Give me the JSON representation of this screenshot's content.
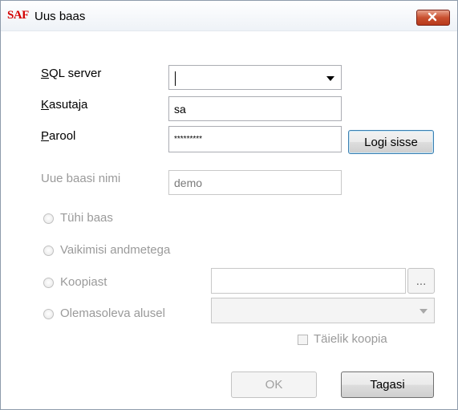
{
  "window": {
    "logo": "SAF",
    "title": "Uus baas"
  },
  "form": {
    "sql_server_label": "SQL server",
    "sql_server_value": "",
    "user_label": "Kasutaja",
    "user_value": "sa",
    "password_label": "Parool",
    "password_value": "*********",
    "login_button": "Logi sisse",
    "db_name_label": "Uue baasi nimi",
    "db_name_value": "demo"
  },
  "options": {
    "empty": "Tühi baas",
    "default_data": "Vaikimisi andmetega",
    "from_copy": "Koopiast",
    "based_on_existing": "Olemasoleva alusel",
    "full_copy": "Täielik koopia",
    "browse_label": "..."
  },
  "buttons": {
    "ok": "OK",
    "back": "Tagasi"
  }
}
